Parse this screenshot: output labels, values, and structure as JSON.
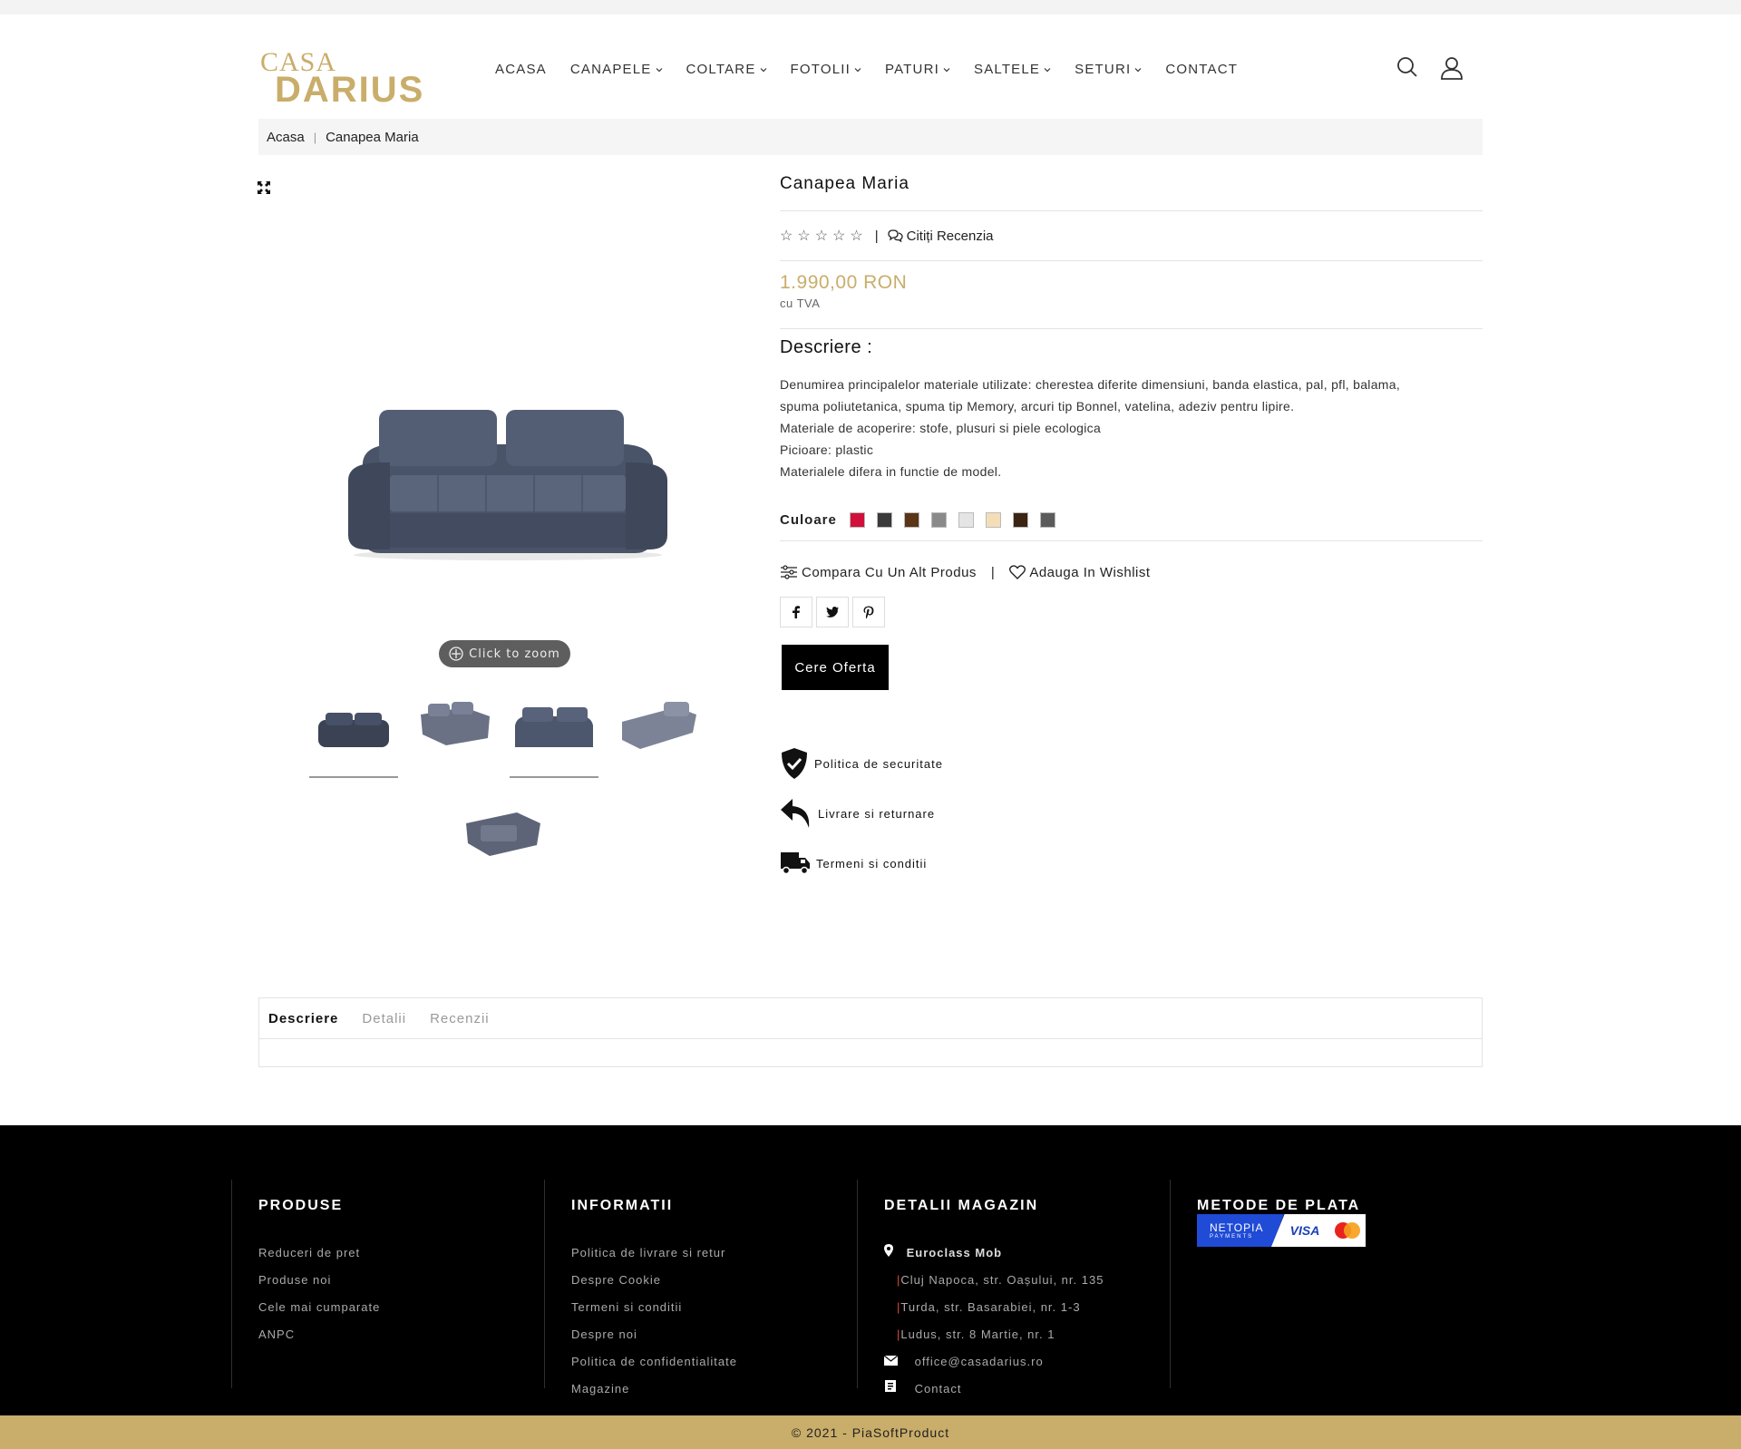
{
  "header": {
    "logo_top": "CASA",
    "logo_bottom": "DARIUS",
    "nav": [
      {
        "label": "ACASA",
        "has_dropdown": false
      },
      {
        "label": "CANAPELE",
        "has_dropdown": true
      },
      {
        "label": "COLTARE",
        "has_dropdown": true
      },
      {
        "label": "FOTOLII",
        "has_dropdown": true
      },
      {
        "label": "PATURI",
        "has_dropdown": true
      },
      {
        "label": "SALTELE",
        "has_dropdown": true
      },
      {
        "label": "SETURI",
        "has_dropdown": true
      },
      {
        "label": "CONTACT",
        "has_dropdown": false
      }
    ],
    "icons": [
      "search-icon",
      "user-icon"
    ]
  },
  "breadcrumb": {
    "home": "Acasa",
    "separator": "|",
    "current": "Canapea Maria"
  },
  "gallery": {
    "zoom_label": "Click to zoom",
    "thumbnail_count": 5
  },
  "product": {
    "title": "Canapea Maria",
    "rating": 0,
    "rating_max": 5,
    "review_link": "Citiți Recenzia",
    "price": "1.990,00 RON",
    "vat_note": "cu TVA",
    "description_heading": "Descriere :",
    "description_lines": [
      "Denumirea principalelor materiale utilizate: cherestea diferite dimensiuni, banda elastica, pal, pfl, balama,",
      "spuma poliutetanica, spuma tip Memory, arcuri tip Bonnel, vatelina, adeziv pentru lipire.",
      "Materiale de acoperire: stofe, plusuri si piele ecologica",
      "Picioare: plastic",
      "Materialele difera in functie de model."
    ],
    "color_label": "Culoare",
    "colors": [
      "#d0103a",
      "#3a3a3a",
      "#5a3516",
      "#8a8a8a",
      "#e4e4e4",
      "#f4deb8",
      "#3b2412",
      "#5b5b5b"
    ],
    "compare_label": "Compara Cu Un Alt Produs",
    "wishlist_label": "Adauga In Wishlist",
    "share_icons": [
      "facebook-icon",
      "twitter-icon",
      "pinterest-icon"
    ],
    "offer_button": "Cere Oferta",
    "features": [
      "Politica de securitate",
      "Livrare si returnare",
      "Termeni si conditii"
    ]
  },
  "tabs": [
    {
      "label": "Descriere",
      "active": true
    },
    {
      "label": "Detalii",
      "active": false
    },
    {
      "label": "Recenzii",
      "active": false
    }
  ],
  "footer": {
    "products": {
      "heading": "PRODUSE",
      "links": [
        "Reduceri de pret",
        "Produse noi",
        "Cele mai cumparate",
        "ANPC"
      ]
    },
    "info": {
      "heading": "INFORMATII",
      "links": [
        "Politica de livrare si retur",
        "Despre Cookie",
        "Termeni si conditii",
        "Despre noi",
        "Politica de confidentialitate",
        "Magazine"
      ]
    },
    "store": {
      "heading": "DETALII MAGAZIN",
      "name": "Euroclass Mob",
      "addresses": [
        "Cluj Napoca, str. Oașului, nr. 135",
        "Turda, str. Basarabiei, nr. 1-3",
        "Ludus, str. 8 Martie, nr. 1"
      ],
      "email": "office@casadarius.ro",
      "contact": "Contact"
    },
    "payment": {
      "heading": "METODE DE PLATA",
      "netopia_line1": "NETOPIA",
      "netopia_line2": "PAYMENTS",
      "visa": "VISA"
    }
  },
  "copyright": "© 2021 - PiaSoftProduct",
  "colors": {
    "accent_gold": "#c9ad6a",
    "footer_bg": "#000000"
  }
}
